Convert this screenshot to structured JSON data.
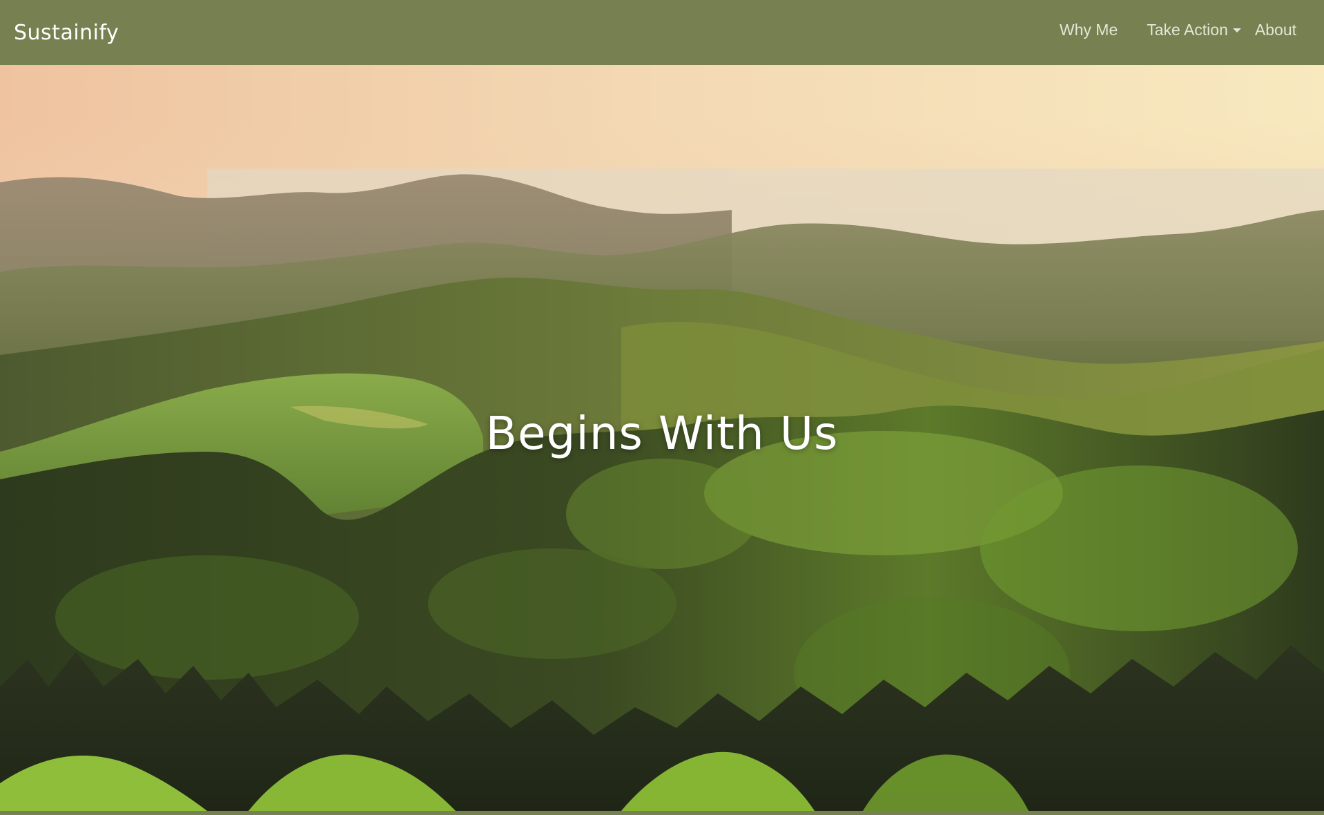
{
  "navbar": {
    "brand": "Sustainify",
    "links": [
      {
        "label": "Why Me"
      },
      {
        "label": "Take Action",
        "has_dropdown": true
      },
      {
        "label": "About"
      }
    ],
    "background_color": "#768050",
    "link_color": "#e3e6d6"
  },
  "hero": {
    "title": "Begins With Us",
    "background_image": "forested-hills-at-sunset",
    "title_color": "#ffffff"
  }
}
